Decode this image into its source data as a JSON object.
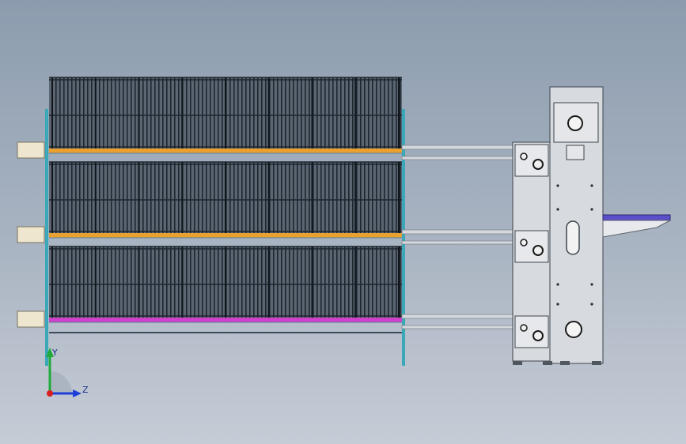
{
  "viewport": {
    "background_top": "#8c9cae",
    "background_bottom": "#c6ccd6"
  },
  "model": {
    "cage_tiers": 3,
    "tier_trough_colors": [
      "#e8a030",
      "#e8a030",
      "#d040c8"
    ],
    "frame_color": "#5a7fa0",
    "wire_color": "#1e2630",
    "post_color": "#3aa8b8",
    "drive_unit_color": "#d7dade",
    "end_box_color": "#efe6cf",
    "belt_color": "#5a4fc8"
  },
  "triad": {
    "y_label": "Y",
    "z_label": "Z",
    "y_color": "#1faa3a",
    "z_color": "#1e3fd8",
    "origin_color": "#d81e1e"
  }
}
